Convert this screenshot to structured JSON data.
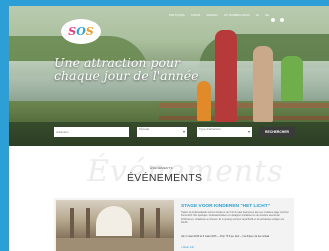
{
  "topnav": [
    "PRATIQUES",
    "TARIFS",
    "AGENDA",
    "OÙ SOMMES-NOUS",
    "NL",
    "EN"
  ],
  "logo": {
    "c1": "S",
    "c2": "O",
    "c3": "S"
  },
  "hero": {
    "tagline": "Une attraction pour chaque jour de l'année"
  },
  "search": {
    "placeholder": "Attraction",
    "period": "Période",
    "type": "Type d'attraction",
    "button": "RECHERCHER"
  },
  "events": {
    "bg_word": "Événements",
    "kicker": "ÉVÉNEMENTS",
    "title": "ÉVÉNEMENTS",
    "card": {
      "title": "STAGE VOOR KINDEREN \"HET LICHT\"",
      "body": "Tijdens de krokusvakantie kunnen kinderen van 6 tot 12 jaar deelnemen aan een creatieve stage rond het thema licht. Met spelletjes, knutselactiviteiten en uitstappen ontdekken ze de wondere wereld van lichtbronnen, schaduwen en kleuren. Er is opvang voorzien vanaf 8u30 en de activiteiten eindigen om 16u30.",
      "meta": "Van 2 maart 2015 tot 6 maart 2015 — Prijs: 75 € per kind — Inschrijven via het onthaal",
      "link": "» Meer info"
    }
  },
  "colors": {
    "accent": "#2ba2dc",
    "frame": "#2b9fd6",
    "button": "#3a3a3a"
  }
}
